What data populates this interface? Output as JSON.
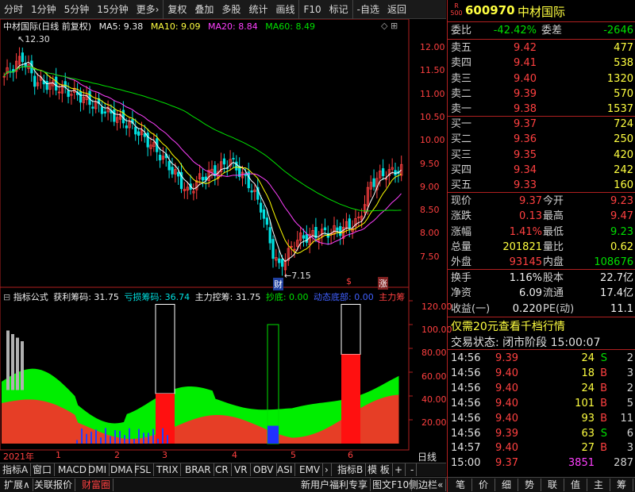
{
  "toolbar": {
    "items": [
      "分时",
      "1分钟",
      "5分钟",
      "15分钟",
      "更多›",
      "复权",
      "叠加",
      "多股",
      "统计",
      "画线",
      "F10",
      "标记",
      "-自选",
      "返回"
    ]
  },
  "kline_header": {
    "title": "中材国际(日线 前复权)",
    "ma5_label": "MA5: 9.38",
    "ma10_label": "MA10: 9.09",
    "ma20_label": "MA20: 8.84",
    "ma60_label": "MA60: 8.49",
    "high_label": "12.30",
    "low_label": "7.15",
    "marker_cai": "财",
    "marker_s": "$",
    "marker_zhang": "涨"
  },
  "price_axis": [
    "12.00",
    "11.50",
    "11.00",
    "10.50",
    "10.00",
    "9.50",
    "9.00",
    "8.50",
    "8.00",
    "7.50"
  ],
  "indicator_header": {
    "name": "指标公式",
    "l1": "获利筹码: 31.75",
    "l2": "亏损筹码: 36.74",
    "l3": "主力控筹: 31.75",
    "l4": "抄底: 0.00",
    "l5": "动态底部: 0.00",
    "l6": "主力筹"
  },
  "ind_axis": [
    "120.00",
    "100.00",
    "80.00",
    "60.00",
    "40.00",
    "20.00"
  ],
  "time_axis": [
    "2021年",
    "1",
    "2",
    "3",
    "4",
    "5",
    "6"
  ],
  "time_axis_right": "日线",
  "ind_tabs": [
    "指标A",
    "窗口",
    "MACD",
    "DMI",
    "DMA",
    "FSL",
    "TRIX",
    "BRAR",
    "CR",
    "VR",
    "OBV",
    "ASI",
    "EMV",
    "›",
    "指标B",
    "模 板",
    "+",
    "-"
  ],
  "bottom_left": [
    "扩展∧",
    "关联报价",
    "财富圈"
  ],
  "bottom_mid": [
    "新用户福利专享",
    "图文F10",
    "侧边栏«"
  ],
  "bottom_right": [
    "笔",
    "价",
    "细",
    "势",
    "联",
    "值",
    "主",
    "筹"
  ],
  "quote": {
    "badge_r": "R",
    "badge_500": "500",
    "code": "600970",
    "name": "中材国际",
    "webi_label": "委比",
    "webi_val": "-42.42%",
    "weicha_label": "委差",
    "weicha_val": "-2646",
    "sell": [
      {
        "label": "卖五",
        "price": "9.42",
        "vol": "477"
      },
      {
        "label": "卖四",
        "price": "9.41",
        "vol": "538"
      },
      {
        "label": "卖三",
        "price": "9.40",
        "vol": "1320"
      },
      {
        "label": "卖二",
        "price": "9.39",
        "vol": "570"
      },
      {
        "label": "卖一",
        "price": "9.38",
        "vol": "1537"
      }
    ],
    "buy": [
      {
        "label": "买一",
        "price": "9.37",
        "vol": "724"
      },
      {
        "label": "买二",
        "price": "9.36",
        "vol": "250"
      },
      {
        "label": "买三",
        "price": "9.35",
        "vol": "420"
      },
      {
        "label": "买四",
        "price": "9.34",
        "vol": "242"
      },
      {
        "label": "买五",
        "price": "9.33",
        "vol": "160"
      }
    ],
    "stats": [
      {
        "l1": "现价",
        "v1": "9.37",
        "l2": "今开",
        "v2": "9.23"
      },
      {
        "l1": "涨跌",
        "v1": "0.13",
        "l2": "最高",
        "v2": "9.47"
      },
      {
        "l1": "涨幅",
        "v1": "1.41%",
        "l2": "最低",
        "v2": "9.23"
      },
      {
        "l1": "总量",
        "v1": "201821",
        "l2": "量比",
        "v2": "0.62"
      },
      {
        "l1": "外盘",
        "v1": "93145",
        "l2": "内盘",
        "v2": "108676"
      }
    ],
    "stats2": [
      {
        "l1": "换手",
        "v1": "1.16%",
        "l2": "股本",
        "v2": "22.7亿"
      },
      {
        "l1": "净资",
        "v1": "6.09",
        "l2": "流通",
        "v2": "17.4亿"
      },
      {
        "l1": "收益(一)",
        "v1": "0.220",
        "l2": "PE(动)",
        "v2": "11.1"
      }
    ],
    "promo": "仅需20元查看千档行情",
    "trade_state": "交易状态: 闭市阶段 15:00:07",
    "ticks": [
      {
        "t": "14:56",
        "p": "9.39",
        "v": "24",
        "d": "S",
        "n": "2"
      },
      {
        "t": "14:56",
        "p": "9.40",
        "v": "18",
        "d": "B",
        "n": "3"
      },
      {
        "t": "14:56",
        "p": "9.40",
        "v": "24",
        "d": "B",
        "n": "2"
      },
      {
        "t": "14:56",
        "p": "9.40",
        "v": "101",
        "d": "B",
        "n": "5"
      },
      {
        "t": "14:56",
        "p": "9.40",
        "v": "93",
        "d": "B",
        "n": "11"
      },
      {
        "t": "14:56",
        "p": "9.39",
        "v": "63",
        "d": "S",
        "n": "6"
      },
      {
        "t": "14:57",
        "p": "9.40",
        "v": "27",
        "d": "B",
        "n": "3"
      },
      {
        "t": "15:00",
        "p": "9.37",
        "v": "3851",
        "d": "",
        "n": "287"
      }
    ]
  },
  "colors": {
    "up": "#ff4040",
    "down": "#00e0e0",
    "ma5": "#ffffff",
    "ma10": "#ffff00",
    "ma20": "#ff40ff",
    "ma60": "#00e000",
    "border": "#b02020"
  }
}
